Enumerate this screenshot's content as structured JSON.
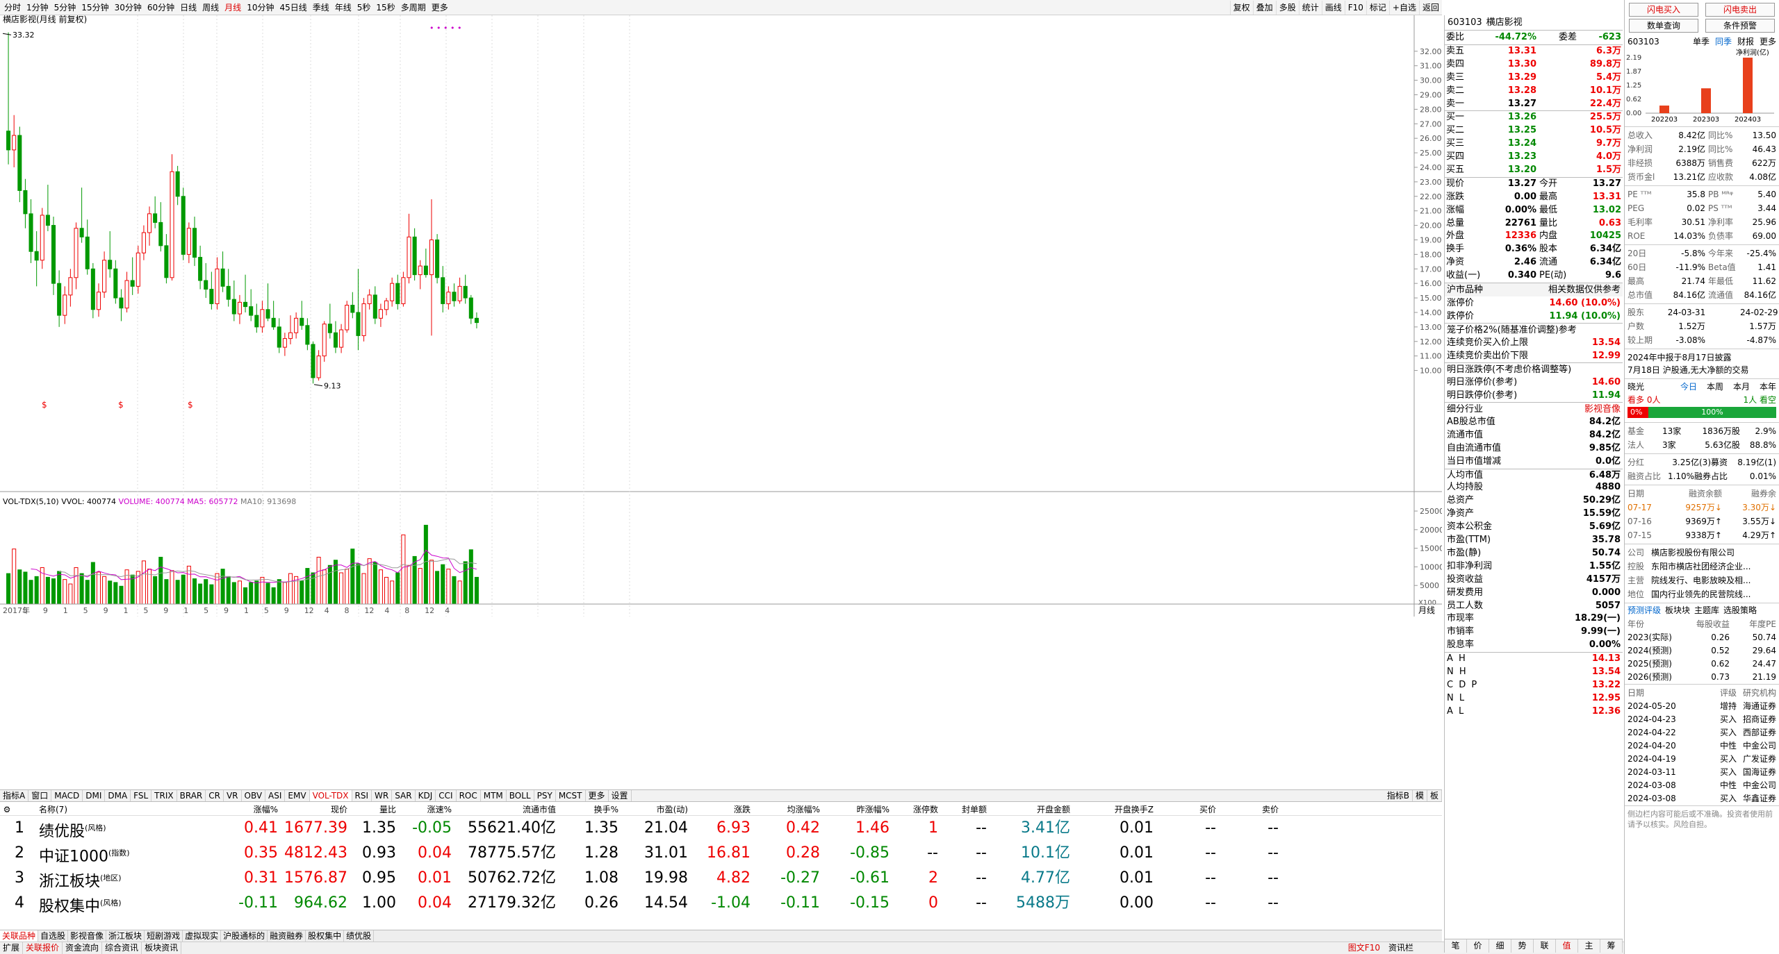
{
  "toolbar": {
    "periods": [
      "分时",
      "1分钟",
      "5分钟",
      "15分钟",
      "30分钟",
      "60分钟",
      "日线",
      "周线",
      "月线",
      "10分钟",
      "45日线",
      "季线",
      "年线",
      "5秒",
      "15秒",
      "多周期",
      "更多"
    ],
    "active": "月线",
    "right": [
      "复权",
      "叠加",
      "多股",
      "统计",
      "画线",
      "F10",
      "标记",
      "+自选",
      "返回"
    ]
  },
  "chart": {
    "title": "横店影视(月线 前复权)",
    "high_label": "33.32",
    "low_label": "9.13",
    "price_ticks": [
      "32.00",
      "31.00",
      "30.00",
      "29.00",
      "28.00",
      "27.00",
      "26.00",
      "25.00",
      "24.00",
      "23.00",
      "22.00",
      "21.00",
      "20.00",
      "19.00",
      "18.00",
      "17.00",
      "16.00",
      "15.00",
      "14.00",
      "13.00",
      "12.00",
      "11.00",
      "10.00"
    ],
    "vol_legend": {
      "name": "VOL-TDX(5,10)",
      "vvol": "VVOL: 400774",
      "volume": "VOLUME: 400774",
      "ma5": "MA5: 605772",
      "ma10": "MA10: 913698"
    },
    "vol_ticks": [
      "25000",
      "20000",
      "15000",
      "10000",
      "5000"
    ],
    "vol_unit": "X100",
    "period_label": "月线",
    "x_labels": [
      "2017年",
      "5",
      "9",
      "1",
      "5",
      "9",
      "1",
      "5",
      "9",
      "1",
      "5",
      "9",
      "1",
      "5",
      "9",
      "12",
      "4",
      "8",
      "12",
      "4",
      "8",
      "12",
      "4"
    ],
    "candles": [
      [
        26.5,
        33.3,
        24.2,
        25.2
      ],
      [
        25.2,
        27.6,
        24.0,
        26.2
      ],
      [
        26.2,
        26.8,
        21.6,
        22.4
      ],
      [
        22.4,
        23.2,
        19.8,
        20.8
      ],
      [
        20.8,
        21.8,
        17.4,
        18.2
      ],
      [
        18.2,
        19.6,
        15.8,
        17.6
      ],
      [
        17.6,
        21.2,
        17.0,
        20.7
      ],
      [
        20.7,
        22.8,
        19.6,
        20.0
      ],
      [
        20.0,
        20.6,
        15.2,
        16.0
      ],
      [
        16.0,
        16.9,
        13.0,
        13.8
      ],
      [
        13.8,
        15.8,
        13.2,
        15.2
      ],
      [
        15.2,
        17.0,
        14.4,
        16.4
      ],
      [
        16.4,
        20.2,
        15.6,
        19.8
      ],
      [
        19.8,
        22.6,
        18.8,
        19.2
      ],
      [
        19.2,
        20.4,
        16.6,
        17.0
      ],
      [
        17.0,
        17.4,
        13.6,
        14.2
      ],
      [
        14.2,
        16.0,
        13.7,
        15.4
      ],
      [
        15.4,
        18.2,
        15.0,
        17.6
      ],
      [
        17.6,
        19.6,
        16.4,
        17.0
      ],
      [
        17.0,
        17.6,
        14.6,
        15.0
      ],
      [
        15.0,
        15.6,
        13.4,
        14.3
      ],
      [
        14.3,
        16.8,
        14.0,
        16.2
      ],
      [
        16.2,
        17.8,
        15.2,
        15.8
      ],
      [
        15.8,
        18.6,
        15.3,
        18.1
      ],
      [
        18.1,
        20.0,
        17.6,
        19.5
      ],
      [
        19.5,
        21.3,
        18.6,
        20.8
      ],
      [
        20.8,
        22.0,
        19.8,
        20.2
      ],
      [
        20.2,
        21.6,
        18.2,
        18.6
      ],
      [
        18.6,
        19.4,
        16.0,
        16.4
      ],
      [
        16.4,
        24.9,
        16.2,
        23.7
      ],
      [
        23.7,
        24.1,
        21.4,
        22.0
      ],
      [
        22.0,
        22.6,
        17.6,
        18.0
      ],
      [
        18.0,
        20.2,
        17.4,
        19.8
      ],
      [
        19.8,
        20.6,
        17.2,
        17.8
      ],
      [
        17.8,
        18.6,
        15.6,
        16.2
      ],
      [
        16.2,
        17.4,
        15.0,
        15.6
      ],
      [
        15.6,
        16.8,
        14.2,
        14.6
      ],
      [
        14.6,
        17.8,
        14.2,
        17.0
      ],
      [
        17.0,
        18.2,
        15.4,
        15.8
      ],
      [
        15.8,
        17.0,
        14.4,
        14.9
      ],
      [
        14.9,
        16.2,
        13.4,
        13.9
      ],
      [
        13.9,
        15.2,
        13.2,
        14.7
      ],
      [
        14.7,
        16.6,
        14.0,
        14.4
      ],
      [
        14.4,
        15.6,
        13.4,
        13.8
      ],
      [
        13.8,
        14.6,
        12.6,
        13.0
      ],
      [
        13.0,
        14.8,
        12.6,
        14.2
      ],
      [
        14.2,
        16.0,
        13.4,
        13.6
      ],
      [
        13.6,
        14.8,
        12.8,
        13.0
      ],
      [
        13.0,
        13.6,
        11.2,
        11.6
      ],
      [
        11.6,
        12.6,
        11.0,
        12.2
      ],
      [
        12.2,
        13.8,
        11.8,
        12.6
      ],
      [
        12.6,
        14.0,
        12.2,
        13.6
      ],
      [
        13.6,
        14.8,
        12.8,
        13.1
      ],
      [
        13.1,
        13.6,
        11.4,
        11.8
      ],
      [
        11.8,
        12.0,
        9.1,
        9.5
      ],
      [
        9.5,
        11.4,
        9.3,
        11.0
      ],
      [
        11.0,
        13.4,
        10.6,
        13.2
      ],
      [
        13.2,
        14.6,
        12.2,
        12.6
      ],
      [
        12.6,
        13.4,
        11.2,
        11.6
      ],
      [
        11.6,
        13.2,
        11.2,
        12.8
      ],
      [
        12.8,
        14.8,
        12.6,
        14.5
      ],
      [
        14.5,
        15.4,
        13.6,
        14.0
      ],
      [
        14.0,
        17.0,
        11.4,
        12.4
      ],
      [
        12.4,
        15.0,
        12.0,
        14.6
      ],
      [
        14.6,
        15.6,
        14.2,
        15.2
      ],
      [
        15.2,
        15.8,
        13.2,
        13.6
      ],
      [
        13.6,
        14.6,
        13.0,
        14.2
      ],
      [
        14.2,
        15.0,
        13.8,
        14.8
      ],
      [
        14.8,
        16.4,
        14.4,
        16.0
      ],
      [
        16.0,
        16.6,
        14.2,
        14.6
      ],
      [
        14.6,
        16.8,
        14.4,
        16.4
      ],
      [
        16.4,
        20.8,
        16.0,
        19.2
      ],
      [
        19.2,
        19.8,
        16.2,
        16.6
      ],
      [
        16.6,
        17.6,
        15.6,
        17.2
      ],
      [
        17.2,
        18.4,
        16.4,
        16.6
      ],
      [
        16.6,
        21.8,
        12.4,
        19.0
      ],
      [
        19.0,
        19.4,
        16.0,
        16.4
      ],
      [
        16.4,
        17.2,
        14.0,
        14.6
      ],
      [
        14.6,
        15.8,
        14.2,
        15.4
      ],
      [
        15.4,
        16.0,
        14.4,
        14.8
      ],
      [
        14.8,
        16.4,
        14.6,
        15.8
      ],
      [
        15.8,
        16.6,
        14.6,
        15.0
      ],
      [
        15.0,
        15.2,
        13.2,
        13.6
      ],
      [
        13.6,
        14.0,
        12.9,
        13.3
      ]
    ],
    "volumes": [
      8200,
      14800,
      9200,
      8600,
      6400,
      7400,
      9800,
      7200,
      6800,
      8800,
      6600,
      5400,
      9800,
      8200,
      6400,
      11200,
      8600,
      7400,
      6200,
      5800,
      4800,
      9200,
      7800,
      8800,
      11600,
      9400,
      7400,
      12600,
      6600,
      9000,
      6400,
      7800,
      10200,
      6800,
      5400,
      6600,
      5200,
      8200,
      9400,
      7400,
      5800,
      6200,
      4400,
      5800,
      6200,
      7200,
      5600,
      4400,
      6600,
      5800,
      8200,
      7400,
      6200,
      9600,
      8400,
      12600,
      9200,
      10400,
      11800,
      8400,
      9400,
      14800,
      10800,
      8200,
      12200,
      11200,
      9200,
      7200,
      6200,
      8400,
      18600,
      10400,
      12800,
      9600,
      21200,
      11800,
      8800,
      10600,
      9400,
      7400,
      6200,
      11400,
      14600,
      7200
    ],
    "markers_top": [
      "• • • •",
      "•"
    ],
    "markers_bottom": [
      "$",
      "$",
      "$"
    ]
  },
  "indicator_tabs": [
    "指标A",
    "窗口",
    "MACD",
    "DMI",
    "DMA",
    "FSL",
    "TRIX",
    "BRAR",
    "CR",
    "VR",
    "OBV",
    "ASI",
    "EMV",
    "VOL-TDX",
    "RSI",
    "WR",
    "SAR",
    "KDJ",
    "CCI",
    "ROC",
    "MTM",
    "BOLL",
    "PSY",
    "MCST",
    "更多",
    "设置"
  ],
  "indicator_active": "VOL-TDX",
  "indicator_right": [
    "指标B",
    "模",
    "板"
  ],
  "table": {
    "headers": [
      "名称(7)",
      "涨幅%",
      "现价",
      "量比",
      "涨速%",
      "流通市值",
      "换手%",
      "市盈(动)",
      "涨跌",
      "均涨幅%",
      "昨涨幅%",
      "涨停数",
      "封单额",
      "开盘金额",
      "开盘换手Z",
      "买价",
      "卖价"
    ],
    "rows": [
      {
        "idx": "1",
        "name": "绩优股",
        "tag": "(风格)",
        "chg": "0.41",
        "price": "1677.39",
        "vr": "1.35",
        "spd": "-0.05",
        "mcap": "55621.40亿",
        "turn": "1.35",
        "pe": "21.04",
        "diff": "6.93",
        "avg": "0.42",
        "yest": "1.46",
        "limit": "1",
        "seal": "--",
        "open": "3.41亿",
        "openturn": "0.01",
        "bid": "--",
        "ask": "--"
      },
      {
        "idx": "2",
        "name": "中证1000",
        "tag": "(指数)",
        "chg": "0.35",
        "price": "4812.43",
        "vr": "0.93",
        "spd": "0.04",
        "mcap": "78775.57亿",
        "turn": "1.28",
        "pe": "31.01",
        "diff": "16.81",
        "avg": "0.28",
        "yest": "-0.85",
        "limit": "--",
        "seal": "--",
        "open": "10.1亿",
        "openturn": "0.01",
        "bid": "--",
        "ask": "--"
      },
      {
        "idx": "3",
        "name": "浙江板块",
        "tag": "(地区)",
        "chg": "0.31",
        "price": "1576.87",
        "vr": "0.95",
        "spd": "0.01",
        "mcap": "50762.72亿",
        "turn": "1.08",
        "pe": "19.98",
        "diff": "4.82",
        "avg": "-0.27",
        "yest": "-0.61",
        "limit": "2",
        "seal": "--",
        "open": "4.77亿",
        "openturn": "0.01",
        "bid": "--",
        "ask": "--"
      },
      {
        "idx": "4",
        "name": "股权集中",
        "tag": "(风格)",
        "chg": "-0.11",
        "price": "964.62",
        "vr": "1.00",
        "spd": "0.04",
        "mcap": "27179.32亿",
        "turn": "0.26",
        "pe": "14.54",
        "diff": "-1.04",
        "avg": "-0.11",
        "yest": "-0.15",
        "limit": "0",
        "seal": "--",
        "open": "5488万",
        "openturn": "0.00",
        "bid": "--",
        "ask": "--"
      }
    ]
  },
  "bottom_tabs": [
    "关联品种",
    "自选股",
    "影视音像",
    "浙江板块",
    "短剧游戏",
    "虚拟现实",
    "沪股通标的",
    "融资融券",
    "股权集中",
    "绩优股"
  ],
  "status_tabs": [
    "扩展",
    "关联报价",
    "资金流向",
    "综合资讯",
    "板块资讯"
  ],
  "status_right": [
    "图文F10",
    "资讯栏"
  ],
  "right_bottom_tabs": [
    "笔",
    "价",
    "细",
    "势",
    "联",
    "值",
    "主",
    "筹"
  ],
  "quote": {
    "code": "603103",
    "name": "横店影视",
    "weibi_label": "委比",
    "weibi": "-44.72%",
    "weicha_label": "委差",
    "weicha": "-623",
    "asks": [
      [
        "卖五",
        "13.31",
        "6.3万"
      ],
      [
        "卖四",
        "13.30",
        "89.8万"
      ],
      [
        "卖三",
        "13.29",
        "5.4万"
      ],
      [
        "卖二",
        "13.28",
        "10.1万"
      ],
      [
        "卖一",
        "13.27",
        "22.4万"
      ]
    ],
    "bids": [
      [
        "买一",
        "13.26",
        "25.5万"
      ],
      [
        "买二",
        "13.25",
        "10.5万"
      ],
      [
        "买三",
        "13.24",
        "9.7万"
      ],
      [
        "买四",
        "13.23",
        "4.0万"
      ],
      [
        "买五",
        "13.20",
        "1.5万"
      ]
    ],
    "stats": [
      [
        "现价",
        "13.27",
        "今开",
        "13.27"
      ],
      [
        "涨跌",
        "0.00",
        "最高",
        "13.31"
      ],
      [
        "涨幅",
        "0.00%",
        "最低",
        "13.02"
      ],
      [
        "总量",
        "22761",
        "量比",
        "0.63"
      ],
      [
        "外盘",
        "12336",
        "内盘",
        "10425"
      ],
      [
        "换手",
        "0.36%",
        "股本",
        "6.34亿"
      ],
      [
        "净资",
        "2.46",
        "流通",
        "6.34亿"
      ],
      [
        "收益(一)",
        "0.340",
        "PE(动)",
        "9.6"
      ]
    ],
    "hu_label": "沪市品种",
    "hu_note": "相关数据仅供参考",
    "limit_up_label": "涨停价",
    "limit_up": "14.60 (10.0%)",
    "limit_dn_label": "跌停价",
    "limit_dn": "11.94 (10.0%)",
    "cage_label": "笼子价格2%(随基准价调整)参考",
    "cage": [
      [
        "连续竞价买入价上限",
        "13.54"
      ],
      [
        "连续竞价卖出价下限",
        "12.99"
      ]
    ],
    "tomorrow_label": "明日涨跌停(不考虑价格调整等)",
    "tomorrow": [
      [
        "明日涨停价(参考)",
        "14.60"
      ],
      [
        "明日跌停价(参考)",
        "11.94"
      ]
    ],
    "industry_label": "细分行业",
    "industry": "影视音像",
    "fin": [
      [
        "AB股总市值",
        "84.2亿"
      ],
      [
        "流通市值",
        "84.2亿"
      ],
      [
        "自由流通市值",
        "9.85亿"
      ],
      [
        "当日市值增减",
        "0.0亿"
      ],
      [
        "人均市值",
        "6.48万"
      ],
      [
        "人均持股",
        "4880"
      ],
      [
        "总资产",
        "50.29亿"
      ],
      [
        "净资产",
        "15.59亿"
      ],
      [
        "资本公积金",
        "5.69亿"
      ],
      [
        "市盈(TTM)",
        "35.78"
      ],
      [
        "市盈(静)",
        "50.74"
      ],
      [
        "扣非净利润",
        "1.55亿"
      ],
      [
        "投资收益",
        "4157万"
      ],
      [
        "研发费用",
        "0.000"
      ],
      [
        "员工人数",
        "5057"
      ],
      [
        "市现率",
        "18.29(一)"
      ],
      [
        "市销率",
        "9.99(一)"
      ],
      [
        "股息率",
        "0.00%"
      ]
    ],
    "indices": [
      [
        "A H",
        "14.13"
      ],
      [
        "N H",
        "13.54"
      ],
      [
        "C D P",
        "13.22"
      ],
      [
        "N L",
        "12.95"
      ],
      [
        "A L",
        "12.36"
      ]
    ]
  },
  "f10": {
    "buttons": [
      [
        "闪电买入",
        "闪电卖出"
      ],
      [
        "数单查询",
        "条件预警"
      ]
    ],
    "code": "603103",
    "tabs": [
      "单季",
      "同季",
      "财报",
      "更多"
    ],
    "chart_title": "净利润(亿)",
    "chart_y": [
      "2.19",
      "1.87",
      "1.25",
      "0.62",
      "0.00"
    ],
    "chart_x": [
      "202203",
      "202303",
      "202403"
    ],
    "chart_values": [
      0.3,
      0.98,
      2.19
    ],
    "kv1": [
      [
        "总收入",
        "8.42亿",
        "同比%",
        "13.50"
      ],
      [
        "净利润",
        "2.19亿",
        "同比%",
        "46.43"
      ],
      [
        "非经损",
        "6388万",
        "销售费",
        "622万"
      ],
      [
        "货币金l",
        "13.21亿",
        "应收款",
        "4.08亿"
      ]
    ],
    "kv2": [
      [
        "PE ᵀᵀᴹ",
        "35.8",
        "PB ᴹᴿᵠ",
        "5.40"
      ],
      [
        "PEG",
        "0.02",
        "PS ᵀᵀᴹ",
        "3.44"
      ],
      [
        "毛利率",
        "30.51",
        "净利率",
        "25.96"
      ],
      [
        "ROE",
        "14.03%",
        "负债率",
        "69.00"
      ]
    ],
    "kv3": [
      [
        "20日",
        "-5.8%",
        "今年来",
        "-25.4%"
      ],
      [
        "60日",
        "-11.9%",
        "Beta值",
        "1.41"
      ],
      [
        "最高",
        "21.74",
        "年最低",
        "11.62"
      ],
      [
        "总市值",
        "84.16亿",
        "流通值",
        "84.16亿"
      ]
    ],
    "kv4": [
      [
        "股东",
        "24-03-31",
        "",
        "24-02-29"
      ],
      [
        "户数",
        "1.52万",
        "",
        "1.57万"
      ],
      [
        "较上期",
        "-3.08%",
        "",
        "-4.87%"
      ]
    ],
    "notice1": "2024年中报于8月17日披露",
    "notice2": "7月18日 沪股通,无大净额的交易",
    "flow_tabs": [
      "晓光",
      "今日",
      "本周",
      "本月",
      "本年"
    ],
    "flow_bull": "看多 0人",
    "flow_bear": "1人 看空",
    "flow_left_pct": "0%",
    "flow_right_pct": "100%",
    "inst": [
      [
        "基金",
        "13家",
        "1836万股",
        "2.9%"
      ],
      [
        "法人",
        "3家",
        "5.63亿股",
        "88.8%"
      ]
    ],
    "dividend": [
      [
        "分红",
        "3.25亿(3)募资",
        "8.19亿(1)"
      ],
      [
        "融资占比",
        "1.10%融券占比",
        "0.01%"
      ]
    ],
    "margin_head": [
      "日期",
      "融资余额",
      "融券余"
    ],
    "margin": [
      [
        "07-17",
        "9257万↓",
        "3.30万↓"
      ],
      [
        "07-16",
        "9369万↑",
        "3.55万↓"
      ],
      [
        "07-15",
        "9338万↑",
        "4.29万↑"
      ]
    ],
    "company": [
      [
        "公司",
        "横店影视股份有限公司"
      ],
      [
        "控股",
        "东阳市横店社团经济企业..."
      ],
      [
        "主营",
        "院线发行、电影放映及相..."
      ],
      [
        "地位",
        "国内行业领先的民营院线..."
      ]
    ],
    "forecast_tabs": [
      "预测评级",
      "板块块",
      "主题库",
      "选股策略"
    ],
    "forecast_head": [
      "年份",
      "每股收益",
      "年度PE"
    ],
    "forecast": [
      [
        "2023(实际)",
        "0.26",
        "50.74"
      ],
      [
        "2024(预测)",
        "0.52",
        "29.64"
      ],
      [
        "2025(预测)",
        "0.62",
        "24.47"
      ],
      [
        "2026(预测)",
        "0.73",
        "21.19"
      ]
    ],
    "rating_head": [
      "日期",
      "评级",
      "研究机构"
    ],
    "ratings": [
      [
        "2024-05-20",
        "增持",
        "海通证券"
      ],
      [
        "2024-04-23",
        "买入",
        "招商证券"
      ],
      [
        "2024-04-22",
        "买入",
        "西部证券"
      ],
      [
        "2024-04-20",
        "中性",
        "中金公司"
      ],
      [
        "2024-04-19",
        "买入",
        "广发证券"
      ],
      [
        "2024-03-11",
        "买入",
        "国海证券"
      ],
      [
        "2024-03-08",
        "中性",
        "中金公司"
      ],
      [
        "2024-03-08",
        "买入",
        "华鑫证券"
      ]
    ],
    "disclaimer": "侧边栏内容可能后或不准确。投资者使用前请予以核实。风险自担。"
  }
}
